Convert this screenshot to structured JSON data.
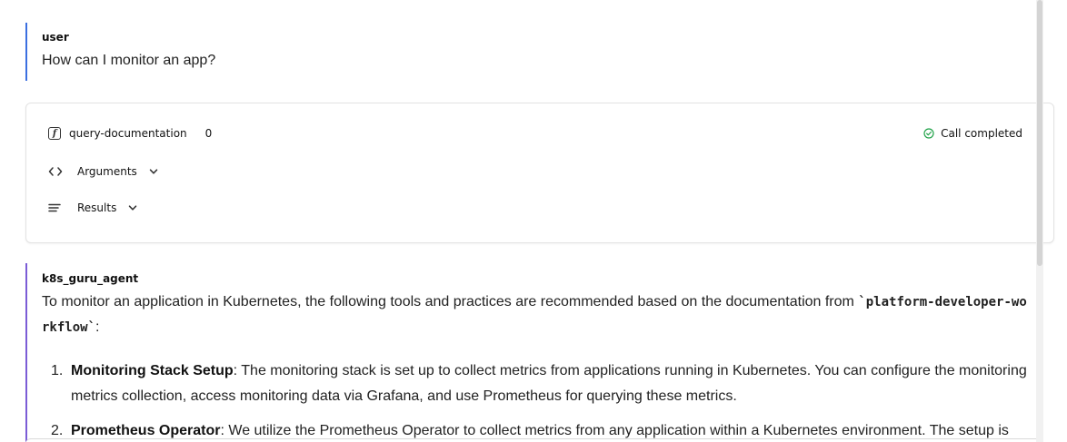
{
  "user_message": {
    "role": "user",
    "text": "How can I monitor an app?"
  },
  "tool_call": {
    "icon": "function-icon",
    "name": "query-documentation",
    "count": "0",
    "status": "Call completed",
    "status_color": "#22a34a",
    "arguments_label": "Arguments",
    "results_label": "Results"
  },
  "agent_message": {
    "role": "k8s_guru_agent",
    "intro_before": "To monitor an application in Kubernetes, the following tools and practices are recommended based on the documentation from ",
    "intro_code": "`platform-developer-workflow`",
    "intro_after": ":",
    "items": [
      {
        "num": "1.",
        "title": "Monitoring Stack Setup",
        "text": ": The monitoring stack is set up to collect metrics from applications running in Kubernetes. You can configure the monitoring metrics collection, access monitoring data via Grafana, and use Prometheus for querying these metrics."
      },
      {
        "num": "2.",
        "title": "Prometheus Operator",
        "text": ": We utilize the Prometheus Operator to collect metrics from any application within a Kubernetes environment. The setup is"
      }
    ]
  },
  "colors": {
    "user_accent": "#3b6fe0",
    "agent_accent": "#7b5cd6"
  }
}
